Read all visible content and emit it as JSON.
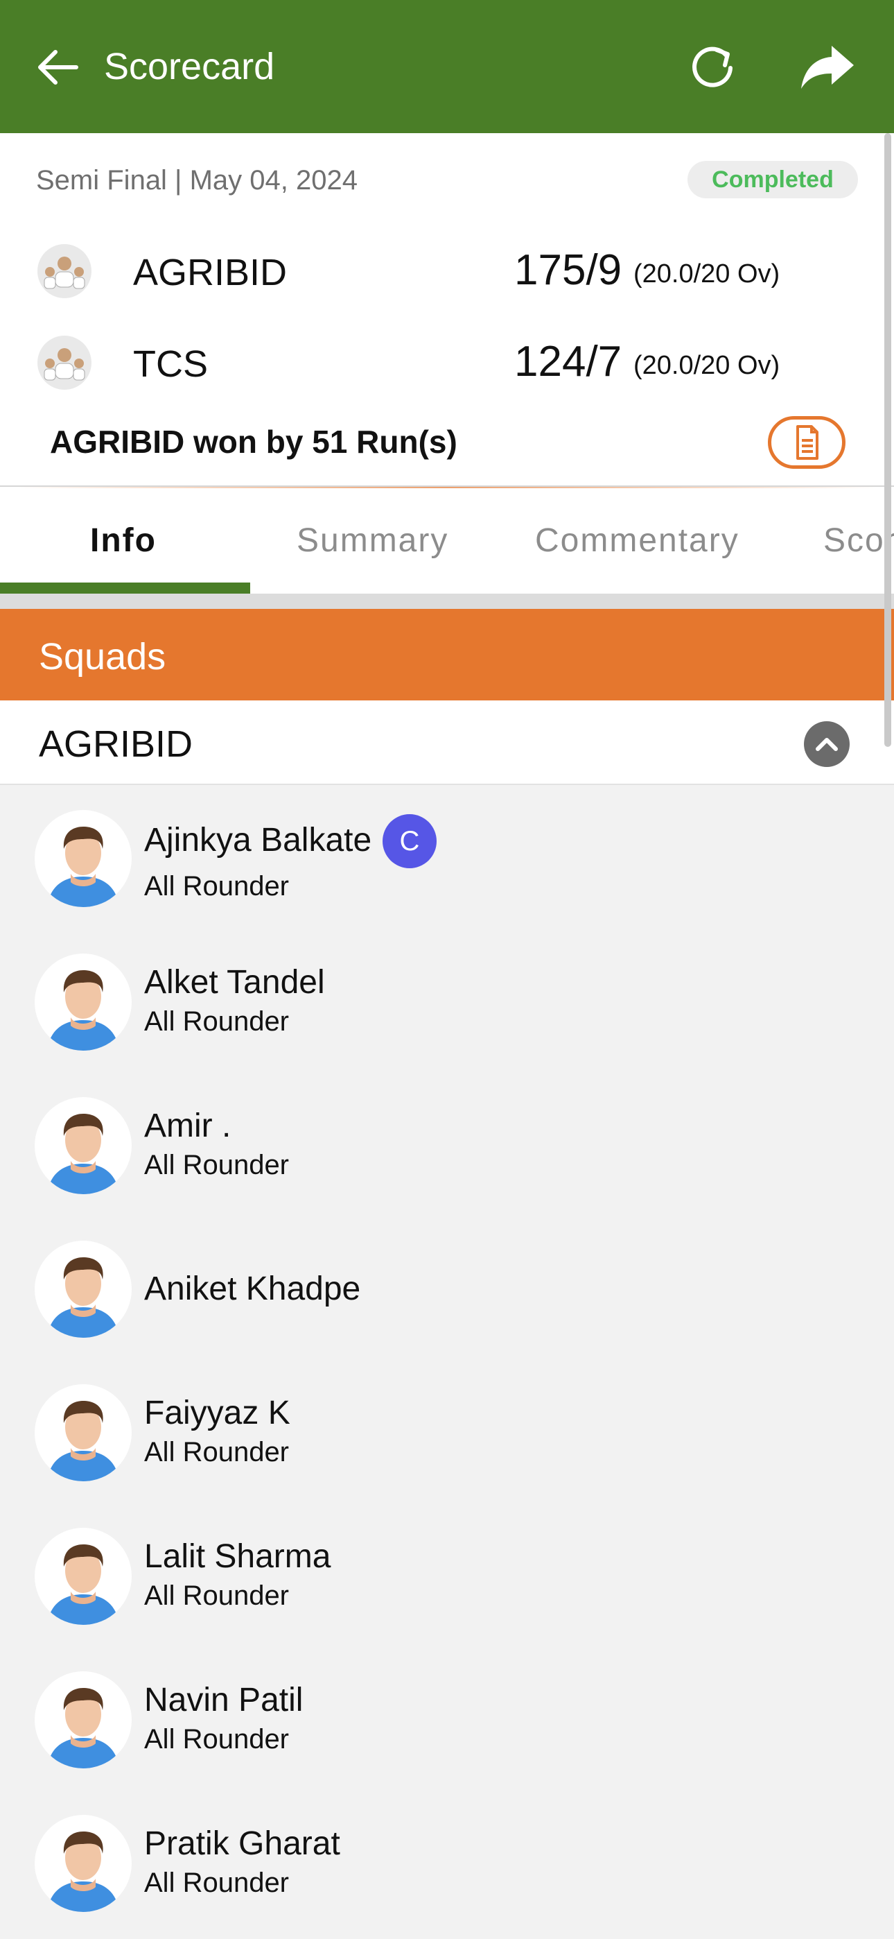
{
  "appbar": {
    "title": "Scorecard",
    "icons": [
      "back-arrow-icon",
      "refresh-icon",
      "share-icon"
    ],
    "color": "#4a7e27"
  },
  "match": {
    "meta": "Semi Final | May 04, 2024",
    "status": "Completed",
    "teams": [
      {
        "name": "AGRIBID",
        "score": "175/9",
        "overs": "(20.0/20 Ov)"
      },
      {
        "name": "TCS",
        "score": "124/7",
        "overs": "(20.0/20 Ov)"
      }
    ],
    "result": "AGRIBID won by 51 Run(s)"
  },
  "tabs": [
    {
      "label": "Info",
      "active": true
    },
    {
      "label": "Summary",
      "active": false
    },
    {
      "label": "Commentary",
      "active": false
    },
    {
      "label": "Scor",
      "active": false
    }
  ],
  "squads": {
    "header": "Squads",
    "header_color": "#e5772e",
    "team": "AGRIBID",
    "captain_badge": "C",
    "players": [
      {
        "name": "Ajinkya Balkate",
        "role": "All Rounder",
        "captain": true
      },
      {
        "name": "Alket Tandel",
        "role": "All Rounder",
        "captain": false
      },
      {
        "name": "Amir .",
        "role": "All Rounder",
        "captain": false
      },
      {
        "name": "Aniket Khadpe",
        "role": "",
        "captain": false
      },
      {
        "name": "Faiyyaz K",
        "role": "All Rounder",
        "captain": false
      },
      {
        "name": "Lalit Sharma",
        "role": "All Rounder",
        "captain": false
      },
      {
        "name": "Navin Patil",
        "role": "All Rounder",
        "captain": false
      },
      {
        "name": "Pratik Gharat",
        "role": "All Rounder",
        "captain": false
      }
    ]
  }
}
